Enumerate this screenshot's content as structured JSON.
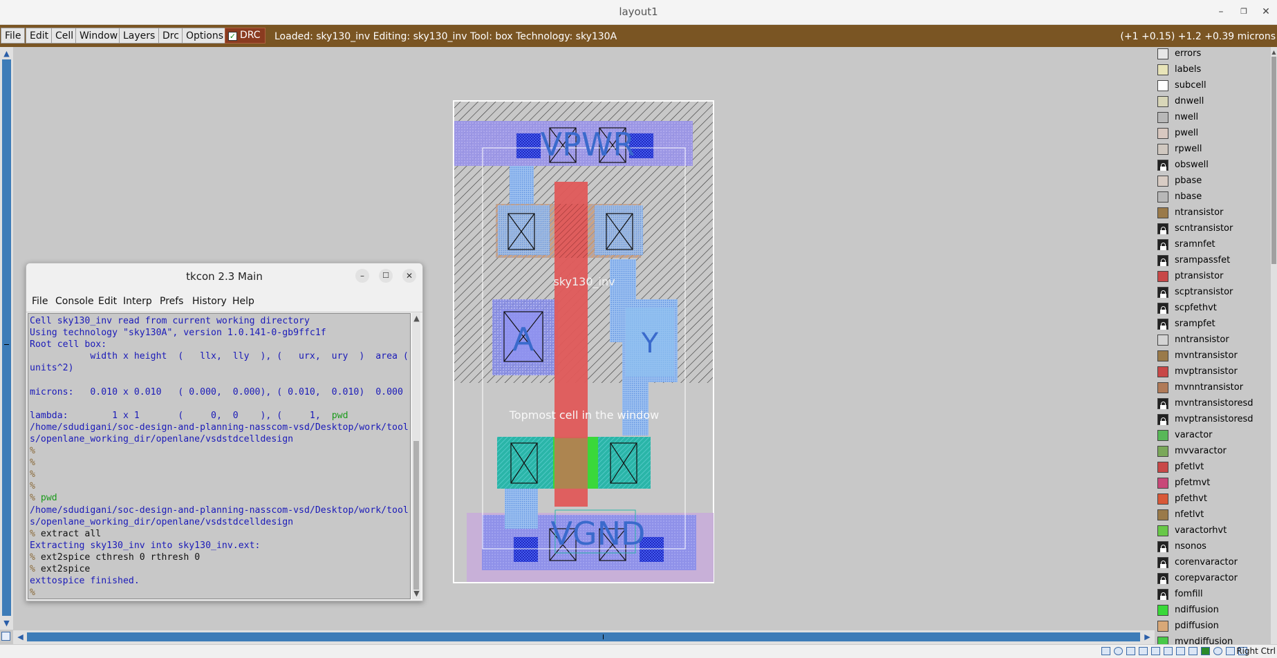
{
  "window": {
    "title": "layout1"
  },
  "menu": {
    "items": [
      "File",
      "Edit",
      "Cell",
      "Window",
      "Layers",
      "Drc",
      "Options"
    ],
    "drc_label": "DRC"
  },
  "status": {
    "text": "Loaded: sky130_inv Editing: sky130_inv Tool: box  Technology: sky130A",
    "coords": "(+1 +0.15) +1.2 +0.39 microns"
  },
  "layout": {
    "labels": {
      "vpwr": "VPWR",
      "vgnd": "VGND",
      "a": "A",
      "y": "Y",
      "cell": "sky130_inv",
      "topmost": "Topmost cell in the window"
    }
  },
  "layers": [
    {
      "name": "errors",
      "color": "#e8e8e8",
      "locked": false
    },
    {
      "name": "labels",
      "color": "#e8e4b8",
      "locked": false
    },
    {
      "name": "subcell",
      "color": "#ffffff",
      "locked": false
    },
    {
      "name": "dnwell",
      "color": "#d8d6b8",
      "locked": false
    },
    {
      "name": "nwell",
      "color": "#b8b8b8",
      "locked": false
    },
    {
      "name": "pwell",
      "color": "#d8c8c0",
      "locked": false
    },
    {
      "name": "rpwell",
      "color": "#d0c8c0",
      "locked": false
    },
    {
      "name": "obswell",
      "color": "#222222",
      "locked": true
    },
    {
      "name": "pbase",
      "color": "#d8ccc4",
      "locked": false
    },
    {
      "name": "nbase",
      "color": "#b8b8b8",
      "locked": false
    },
    {
      "name": "ntransistor",
      "color": "#9a7a4a",
      "locked": false
    },
    {
      "name": "scntransistor",
      "color": "#222222",
      "locked": true
    },
    {
      "name": "sramnfet",
      "color": "#222222",
      "locked": true
    },
    {
      "name": "srampassfet",
      "color": "#222222",
      "locked": true
    },
    {
      "name": "ptransistor",
      "color": "#c84848",
      "locked": false
    },
    {
      "name": "scptransistor",
      "color": "#222222",
      "locked": true
    },
    {
      "name": "scpfethvt",
      "color": "#222222",
      "locked": true
    },
    {
      "name": "srampfet",
      "color": "#222222",
      "locked": true
    },
    {
      "name": "nntransistor",
      "color": "#d4d4d4",
      "locked": false
    },
    {
      "name": "mvntransistor",
      "color": "#9a7a4a",
      "locked": false
    },
    {
      "name": "mvptransistor",
      "color": "#c84848",
      "locked": false
    },
    {
      "name": "mvnntransistor",
      "color": "#b07a58",
      "locked": false
    },
    {
      "name": "mvntransistoresd",
      "color": "#222222",
      "locked": true
    },
    {
      "name": "mvptransistoresd",
      "color": "#222222",
      "locked": true
    },
    {
      "name": "varactor",
      "color": "#58b858",
      "locked": false
    },
    {
      "name": "mvvaractor",
      "color": "#7aa85a",
      "locked": false
    },
    {
      "name": "pfetlvt",
      "color": "#c84848",
      "locked": false
    },
    {
      "name": "pfetmvt",
      "color": "#c84878",
      "locked": false
    },
    {
      "name": "pfethvt",
      "color": "#d85838",
      "locked": false
    },
    {
      "name": "nfetlvt",
      "color": "#9a7a4a",
      "locked": false
    },
    {
      "name": "varactorhvt",
      "color": "#68c848",
      "locked": false
    },
    {
      "name": "nsonos",
      "color": "#222222",
      "locked": true
    },
    {
      "name": "corenvaractor",
      "color": "#222222",
      "locked": true
    },
    {
      "name": "corepvaractor",
      "color": "#222222",
      "locked": true
    },
    {
      "name": "fomfill",
      "color": "#222222",
      "locked": true
    },
    {
      "name": "ndiffusion",
      "color": "#38d838",
      "locked": false
    },
    {
      "name": "pdiffusion",
      "color": "#d8a878",
      "locked": false
    },
    {
      "name": "mvndiffusion",
      "color": "#48c848",
      "locked": false
    }
  ],
  "tkcon": {
    "title": "tkcon 2.3 Main",
    "menu": [
      "File",
      "Console",
      "Edit",
      "Interp",
      "Prefs",
      "History",
      "Help"
    ],
    "lines": [
      {
        "t": "Cell sky130_inv read from current working directory",
        "c": "o"
      },
      {
        "t": "Using technology \"sky130A\", version 1.0.141-0-gb9ffc1f",
        "c": "o"
      },
      {
        "t": "Root cell box:",
        "c": "o"
      },
      {
        "t": "           width x height  (   llx,  lly  ), (   urx,  ury  )  area (",
        "c": "o"
      },
      {
        "t": "units^2)",
        "c": "o"
      },
      {
        "t": "",
        "c": "o"
      },
      {
        "t": "microns:   0.010 x 0.010   ( 0.000,  0.000), ( 0.010,  0.010)  0.000",
        "c": "o"
      },
      {
        "t": "",
        "c": "o"
      },
      {
        "t": "lambda:        1 x 1       (     0,  0    ), (     1,  ",
        "c": "o",
        "g": "pwd"
      },
      {
        "t": "/home/sdudigani/soc-design-and-planning-nasscom-vsd/Desktop/work/tool",
        "c": "o"
      },
      {
        "t": "s/openlane_working_dir/openlane/vsdstdcelldesign",
        "c": "o"
      },
      {
        "t": "%",
        "c": "p"
      },
      {
        "t": "%",
        "c": "p"
      },
      {
        "t": "%",
        "c": "p"
      },
      {
        "t": "%",
        "c": "p"
      },
      {
        "t": "% ",
        "c": "p",
        "g": "pwd"
      },
      {
        "t": "/home/sdudigani/soc-design-and-planning-nasscom-vsd/Desktop/work/tool",
        "c": "o"
      },
      {
        "t": "s/openlane_working_dir/openlane/vsdstdcelldesign",
        "c": "o"
      },
      {
        "t": "% ",
        "c": "p",
        "k": "extract all"
      },
      {
        "t": "Extracting sky130_inv into sky130_inv.ext:",
        "c": "o"
      },
      {
        "t": "% ",
        "c": "p",
        "k": "ext2spice cthresh 0 rthresh 0"
      },
      {
        "t": "% ",
        "c": "p",
        "k": "ext2spice"
      },
      {
        "t": "exttospice finished.",
        "c": "o"
      },
      {
        "t": "%",
        "c": "p"
      }
    ]
  },
  "statusbar": {
    "right": "Right Ctrl"
  }
}
